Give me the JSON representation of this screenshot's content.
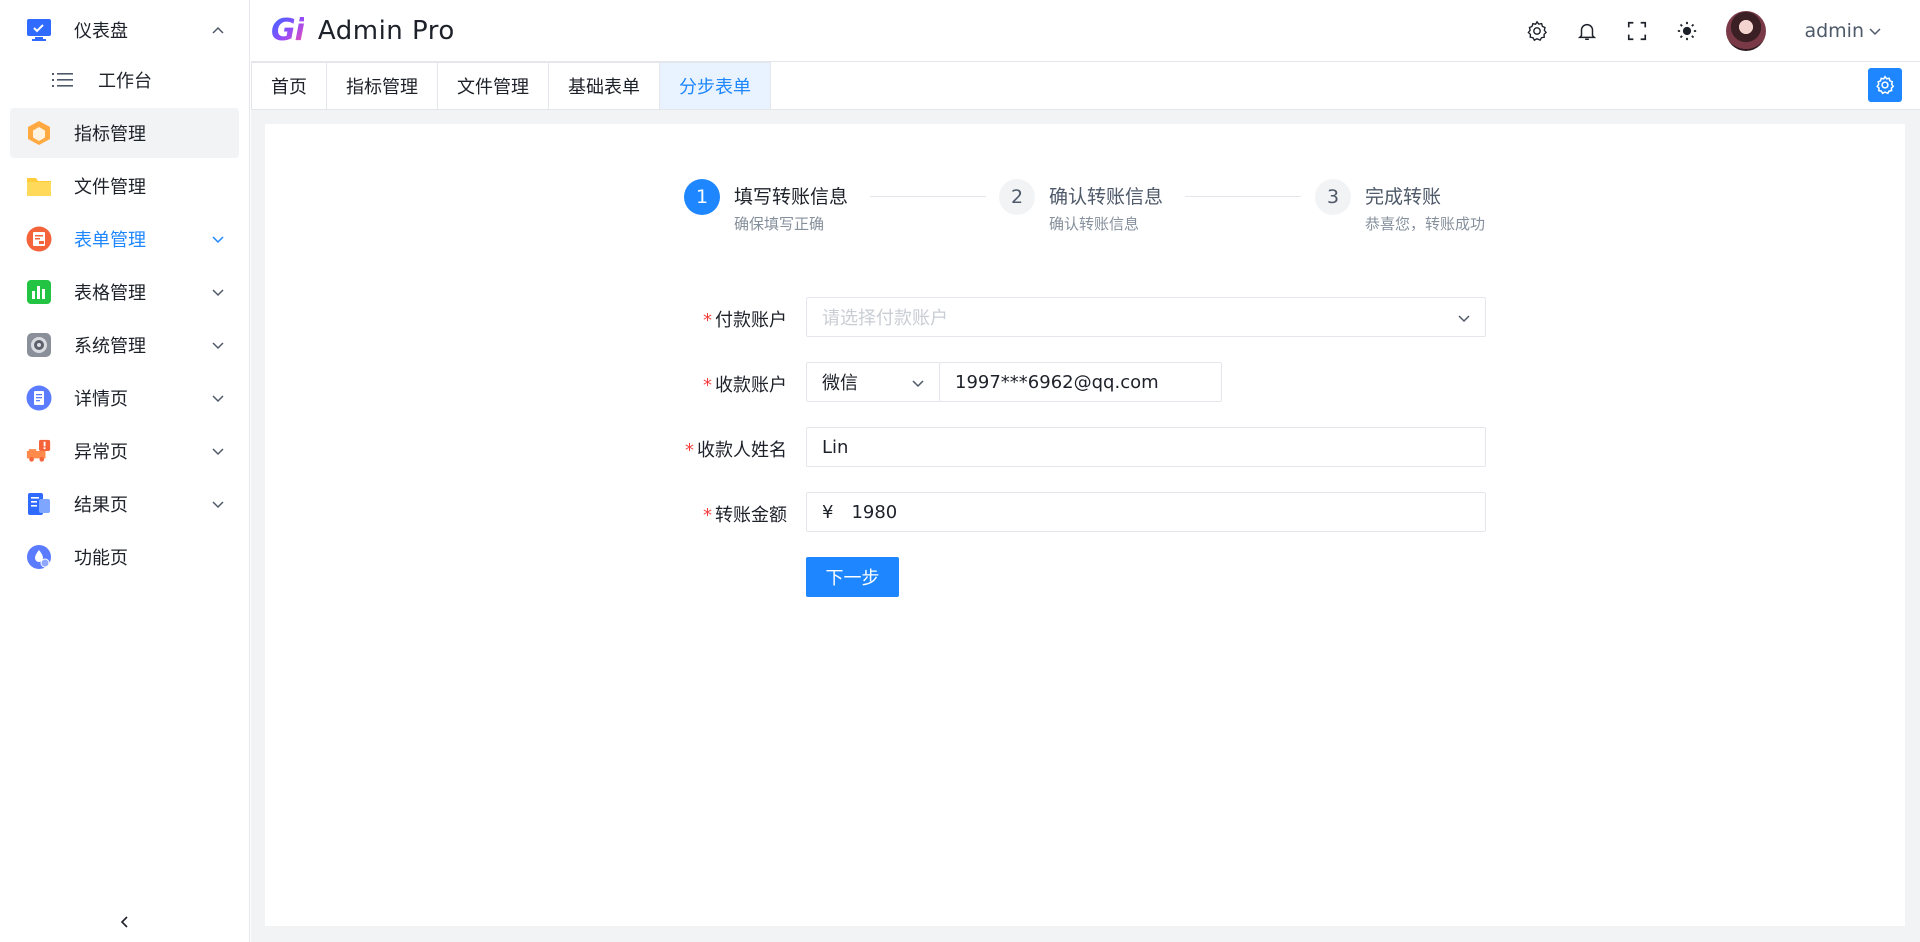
{
  "app": {
    "logo_mark": "Gi",
    "title": "Admin Pro"
  },
  "sidebar": {
    "items": [
      {
        "label": "仪表盘",
        "icon": "monitor-icon",
        "state": "expanded"
      },
      {
        "label": "工作台",
        "icon": "list-icon",
        "state": "sub"
      },
      {
        "label": "指标管理",
        "icon": "hexagon-icon",
        "state": "selected"
      },
      {
        "label": "文件管理",
        "icon": "folder-icon",
        "state": "leaf"
      },
      {
        "label": "表单管理",
        "icon": "form-icon",
        "state": "open"
      },
      {
        "label": "表格管理",
        "icon": "bar-chart-icon",
        "state": "collapsed"
      },
      {
        "label": "系统管理",
        "icon": "system-icon",
        "state": "collapsed"
      },
      {
        "label": "详情页",
        "icon": "document-icon",
        "state": "collapsed"
      },
      {
        "label": "异常页",
        "icon": "warning-truck-icon",
        "state": "collapsed"
      },
      {
        "label": "结果页",
        "icon": "result-icon",
        "state": "collapsed"
      },
      {
        "label": "功能页",
        "icon": "function-icon",
        "state": "leaf"
      }
    ],
    "collapse_icon": "chevron-left-icon"
  },
  "header": {
    "icons": [
      "settings-icon",
      "bell-icon",
      "fullscreen-icon",
      "theme-sun-icon"
    ],
    "user": "admin"
  },
  "tabs": [
    {
      "label": "首页",
      "active": false
    },
    {
      "label": "指标管理",
      "active": false
    },
    {
      "label": "文件管理",
      "active": false
    },
    {
      "label": "基础表单",
      "active": false
    },
    {
      "label": "分步表单",
      "active": true
    }
  ],
  "steps": [
    {
      "number": "1",
      "title": "填写转账信息",
      "desc": "确保填写正确",
      "active": true
    },
    {
      "number": "2",
      "title": "确认转账信息",
      "desc": "确认转账信息",
      "active": false
    },
    {
      "number": "3",
      "title": "完成转账",
      "desc": "恭喜您，转账成功",
      "active": false
    }
  ],
  "form": {
    "pay_account": {
      "label": "付款账户",
      "placeholder": "请选择付款账户",
      "value": ""
    },
    "receive_account": {
      "label": "收款账户",
      "type_value": "微信",
      "value": "1997***6962@qq.com"
    },
    "receiver_name": {
      "label": "收款人姓名",
      "value": "Lin"
    },
    "amount": {
      "label": "转账金额",
      "prefix": "¥",
      "value": "1980"
    },
    "required_mark": "*",
    "next_button": "下一步"
  },
  "colors": {
    "primary": "#1e87ff",
    "required": "#f53f3f",
    "content_bg": "#f2f3f5"
  }
}
